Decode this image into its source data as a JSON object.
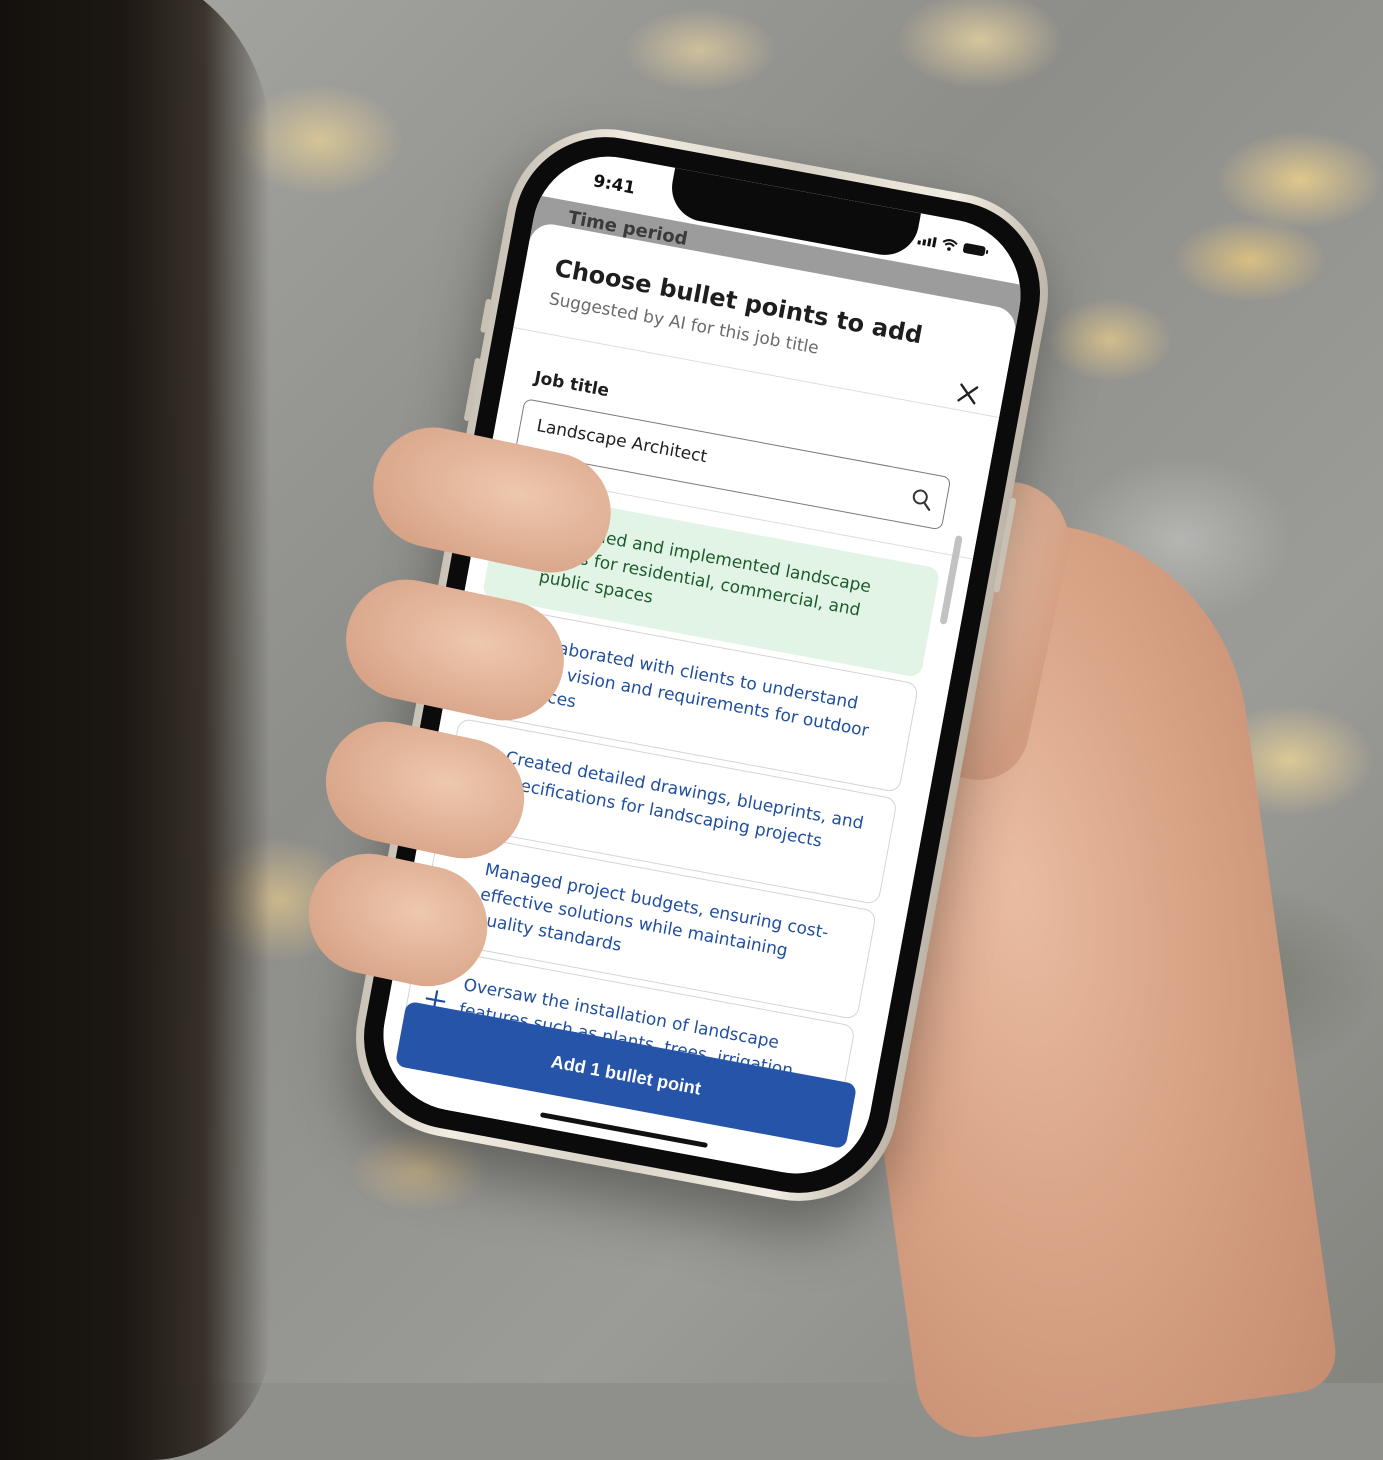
{
  "status_bar": {
    "time": "9:41"
  },
  "background_screen": {
    "label": "Time period"
  },
  "sheet": {
    "title": "Choose bullet points to add",
    "subtitle": "Suggested by AI for this job title"
  },
  "job_title": {
    "label": "Job title",
    "value": "Landscape Architect"
  },
  "suggestions": [
    {
      "text": "Designed and implemented landscape plans for residential, commercial, and public spaces",
      "selected": true,
      "icon": "check-icon"
    },
    {
      "text": "Collaborated with clients to understand their vision and requirements for outdoor spaces",
      "selected": false,
      "icon": "plus-icon"
    },
    {
      "text": "Created detailed drawings, blueprints, and specifications for landscaping projects",
      "selected": false,
      "icon": "plus-icon"
    },
    {
      "text": "Managed project budgets, ensuring cost-effective solutions while maintaining quality standards",
      "selected": false,
      "icon": "plus-icon"
    },
    {
      "text": "Oversaw the installation of landscape features such as plants, trees, irrigation systems, and hardscapes",
      "selected": false,
      "icon": "plus-icon"
    }
  ],
  "cta": {
    "label": "Add 1 bullet point"
  },
  "colors": {
    "primary": "#2654a8",
    "link_text": "#1f4e9e",
    "selected_bg": "#e1f4e5",
    "selected_text": "#1e5b2c"
  }
}
